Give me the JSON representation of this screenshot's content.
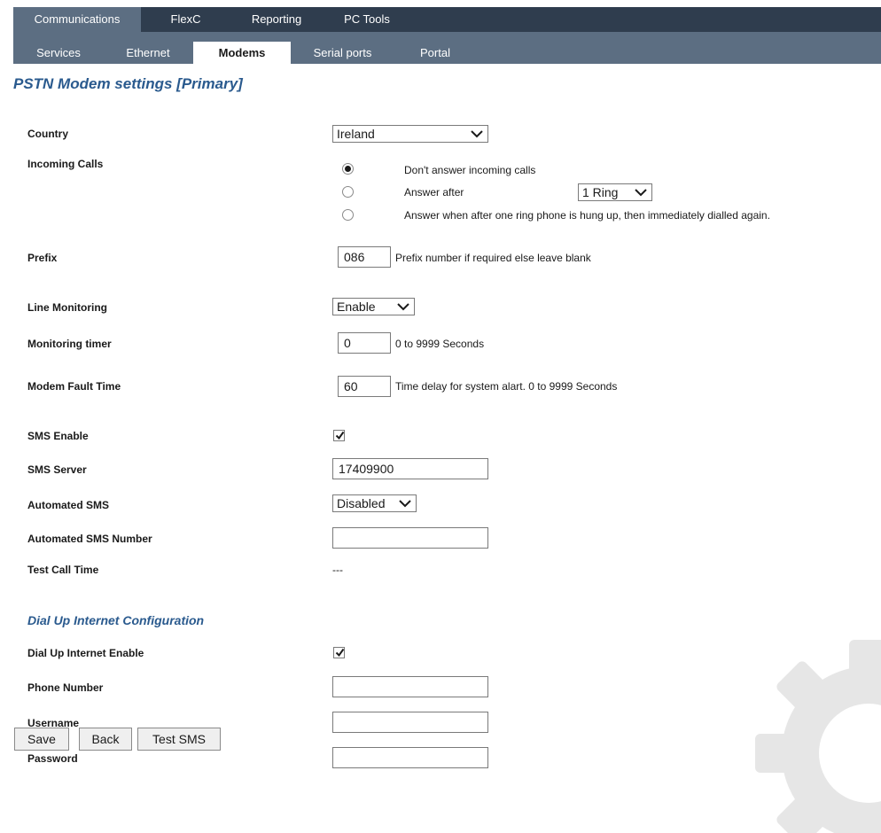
{
  "nav": {
    "tabs": [
      "Communications",
      "FlexC",
      "Reporting",
      "PC Tools"
    ],
    "subtabs": [
      "Services",
      "Ethernet",
      "Modems",
      "Serial ports",
      "Portal"
    ]
  },
  "page_title": "PSTN Modem settings [Primary]",
  "country": {
    "label": "Country",
    "value": "Ireland"
  },
  "incoming_calls": {
    "label": "Incoming Calls",
    "options": [
      "Don't answer incoming calls",
      "Answer after",
      "Answer when after one ring phone is hung up, then immediately dialled again."
    ],
    "selected": 0,
    "rings_value": "1 Ring"
  },
  "prefix": {
    "label": "Prefix",
    "value": "086",
    "help": "Prefix number if required else leave blank"
  },
  "line_monitoring": {
    "label": "Line Monitoring",
    "value": "Enable"
  },
  "monitoring_timer": {
    "label": "Monitoring timer",
    "value": "0",
    "help": "0 to 9999 Seconds"
  },
  "modem_fault_time": {
    "label": "Modem Fault Time",
    "value": "60",
    "help": "Time delay for system alart. 0 to 9999 Seconds"
  },
  "sms_enable": {
    "label": "SMS Enable",
    "checked": true
  },
  "sms_server": {
    "label": "SMS Server",
    "value": "17409900"
  },
  "automated_sms": {
    "label": "Automated SMS",
    "value": "Disabled"
  },
  "automated_sms_number": {
    "label": "Automated SMS Number",
    "value": ""
  },
  "test_call_time": {
    "label": "Test Call Time",
    "value": "---"
  },
  "dialup": {
    "title": "Dial Up Internet Configuration",
    "enable_label": "Dial Up Internet Enable",
    "enable_checked": true,
    "phone_label": "Phone Number",
    "phone_value": "",
    "username_label": "Username",
    "username_value": "",
    "password_label": "Password",
    "password_value": ""
  },
  "buttons": {
    "save": "Save",
    "back": "Back",
    "test_sms": "Test SMS"
  },
  "colors": {
    "nav_dark": "#2f3d4e",
    "nav_mid": "#5c6e82",
    "heading_blue": "#2a5a8e",
    "gear": "#e6e6e6"
  },
  "icons": [
    "chevron-down-icon",
    "checkmark-icon",
    "gear-icon"
  ]
}
